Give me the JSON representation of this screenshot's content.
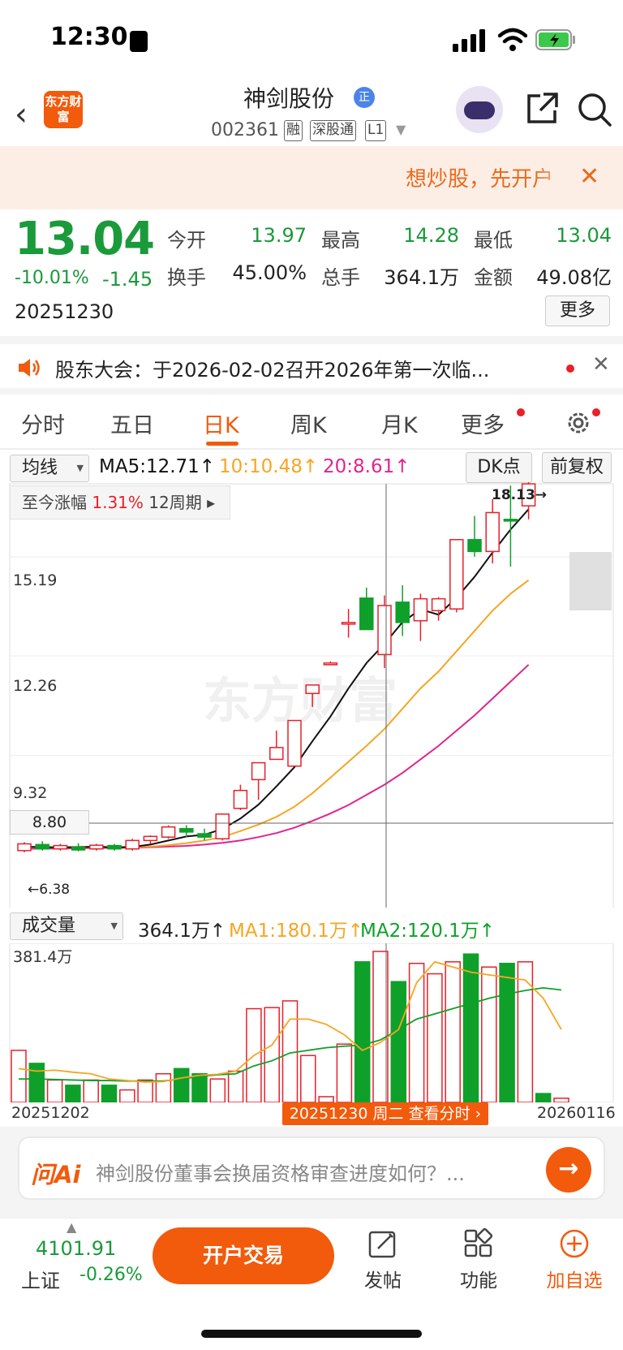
{
  "status": {
    "time": "12:30"
  },
  "header": {
    "logo": "东方财富",
    "title": "神剑股份",
    "title_badge": "正",
    "code": "002361",
    "tags": [
      "融",
      "深股通",
      "L1"
    ]
  },
  "banner": {
    "text": "想炒股，先开户"
  },
  "quote": {
    "price": "13.04",
    "change_pct": "-10.01%",
    "change": "-1.45",
    "date": "20251230",
    "fields": [
      {
        "label": "今开",
        "value": "13.97",
        "color": "#1a9a3a"
      },
      {
        "label": "最高",
        "value": "14.28",
        "color": "#1a9a3a"
      },
      {
        "label": "最低",
        "value": "13.04",
        "color": "#1a9a3a"
      },
      {
        "label": "换手",
        "value": "45.00%",
        "color": "#222222"
      },
      {
        "label": "总手",
        "value": "364.1万",
        "color": "#222222"
      },
      {
        "label": "金额",
        "value": "49.08亿",
        "color": "#222222"
      }
    ],
    "more": "更多"
  },
  "notice": {
    "text": "股东大会：于2026-02-02召开2026年第一次临..."
  },
  "tabs": [
    {
      "label": "分时"
    },
    {
      "label": "五日"
    },
    {
      "label": "日K",
      "active": true
    },
    {
      "label": "周K"
    },
    {
      "label": "月K"
    },
    {
      "label": "更多"
    }
  ],
  "chart": {
    "ma_select": "均线",
    "ma5": "MA5:12.71↑",
    "ma10": "10:10.48↑",
    "ma20": "20:8.61↑",
    "dk_button": "DK点",
    "adjust_button": "前复权",
    "period_label": "至今涨幅",
    "period_value": "1.31%",
    "period_span": "12周期",
    "y_labels": [
      "15.19",
      "12.26",
      "9.32"
    ],
    "crosshair_price": "8.80",
    "high_label": "18.13",
    "low_label": "6.38",
    "vol_select": "成交量",
    "vol_value": "364.1万↑",
    "vol_ma1": "MA1:180.1万↑",
    "vol_ma2": "MA2:120.1万↑",
    "vol_max": "381.4万",
    "x_start": "20251202",
    "x_end": "20260116",
    "crosshair_date": "20251230 周二 查看分时",
    "watermark": "东方财富",
    "colors": {
      "up": "#e8202a",
      "down": "#0fa02a",
      "ma5": "#111111",
      "ma10": "#f5a623",
      "ma20": "#e0258e"
    }
  },
  "chart_data": {
    "type": "candlestick",
    "x_range": [
      "20251202",
      "20260116"
    ],
    "y_ticks": [
      15.19,
      12.26,
      9.32
    ],
    "candles": [
      {
        "o": 6.5,
        "h": 6.75,
        "l": 6.45,
        "c": 6.7
      },
      {
        "o": 6.68,
        "h": 6.78,
        "l": 6.5,
        "c": 6.55
      },
      {
        "o": 6.55,
        "h": 6.7,
        "l": 6.5,
        "c": 6.65
      },
      {
        "o": 6.6,
        "h": 6.72,
        "l": 6.48,
        "c": 6.52
      },
      {
        "o": 6.55,
        "h": 6.7,
        "l": 6.5,
        "c": 6.66
      },
      {
        "o": 6.65,
        "h": 6.7,
        "l": 6.5,
        "c": 6.55
      },
      {
        "o": 6.55,
        "h": 6.85,
        "l": 6.5,
        "c": 6.8
      },
      {
        "o": 6.8,
        "h": 6.95,
        "l": 6.7,
        "c": 6.92
      },
      {
        "o": 6.9,
        "h": 7.25,
        "l": 6.85,
        "c": 7.2
      },
      {
        "o": 7.15,
        "h": 7.25,
        "l": 6.9,
        "c": 7.05
      },
      {
        "o": 7.0,
        "h": 7.15,
        "l": 6.8,
        "c": 6.9
      },
      {
        "o": 6.85,
        "h": 7.6,
        "l": 6.8,
        "c": 7.58
      },
      {
        "o": 7.75,
        "h": 8.45,
        "l": 7.7,
        "c": 8.28
      },
      {
        "o": 8.6,
        "h": 9.1,
        "l": 8.0,
        "c": 9.1
      },
      {
        "o": 9.2,
        "h": 10.05,
        "l": 9.2,
        "c": 9.55
      },
      {
        "o": 9.0,
        "h": 10.35,
        "l": 9.0,
        "c": 10.35
      },
      {
        "o": 11.15,
        "h": 11.4,
        "l": 10.75,
        "c": 11.4
      },
      {
        "o": 12.0,
        "h": 12.1,
        "l": 12.0,
        "c": 12.05
      },
      {
        "o": 13.25,
        "h": 13.65,
        "l": 12.8,
        "c": 13.25
      },
      {
        "o": 13.97,
        "h": 14.28,
        "l": 13.04,
        "c": 13.04
      },
      {
        "o": 12.3,
        "h": 14.05,
        "l": 11.9,
        "c": 13.75
      },
      {
        "o": 13.85,
        "h": 14.35,
        "l": 12.85,
        "c": 13.25
      },
      {
        "o": 13.3,
        "h": 14.1,
        "l": 12.7,
        "c": 13.95
      },
      {
        "o": 13.6,
        "h": 14.0,
        "l": 13.3,
        "c": 13.95
      },
      {
        "o": 13.65,
        "h": 15.7,
        "l": 13.55,
        "c": 15.7
      },
      {
        "o": 15.7,
        "h": 16.4,
        "l": 15.2,
        "c": 15.35
      },
      {
        "o": 15.35,
        "h": 16.9,
        "l": 15.0,
        "c": 16.5
      },
      {
        "o": 16.3,
        "h": 17.3,
        "l": 14.9,
        "c": 16.25
      },
      {
        "o": 16.7,
        "h": 18.13,
        "l": 16.3,
        "c": 17.35
      }
    ],
    "ma5": [
      6.62,
      6.6,
      6.6,
      6.6,
      6.62,
      6.59,
      6.61,
      6.68,
      6.8,
      6.92,
      6.97,
      7.14,
      7.45,
      7.86,
      8.4,
      8.97,
      9.74,
      10.47,
      11.3,
      12.05,
      12.62,
      13.26,
      13.64,
      13.48,
      13.98,
      14.6,
      15.32,
      16.0,
      16.6
    ],
    "ma10": [
      6.6,
      6.6,
      6.6,
      6.61,
      6.61,
      6.61,
      6.61,
      6.62,
      6.66,
      6.72,
      6.8,
      6.9,
      7.08,
      7.27,
      7.5,
      7.8,
      8.2,
      8.66,
      9.13,
      9.6,
      10.1,
      10.7,
      11.3,
      11.8,
      12.4,
      13.0,
      13.6,
      14.1,
      14.5
    ],
    "ma20": [
      6.55,
      6.56,
      6.56,
      6.57,
      6.58,
      6.58,
      6.59,
      6.6,
      6.62,
      6.64,
      6.68,
      6.73,
      6.8,
      6.9,
      7.02,
      7.18,
      7.38,
      7.6,
      7.85,
      8.15,
      8.45,
      8.8,
      9.2,
      9.6,
      10.05,
      10.5,
      11.0,
      11.5,
      12.0
    ],
    "volume": [
      100,
      75,
      43,
      33,
      43,
      33,
      24,
      43,
      55,
      65,
      55,
      45,
      60,
      180,
      182,
      195,
      90,
      11,
      112,
      270,
      290,
      232,
      267,
      247,
      270,
      285,
      260,
      267,
      270,
      17,
      8
    ],
    "vol_ma1": [
      65,
      60,
      62,
      58,
      55,
      45,
      42,
      39,
      40,
      47,
      52,
      54,
      60,
      90,
      110,
      160,
      160,
      150,
      130,
      100,
      115,
      140,
      230,
      270,
      260,
      250,
      245,
      240,
      235,
      200,
      140
    ],
    "vol_ma2": [
      45,
      45,
      44,
      43,
      42,
      42,
      41,
      41,
      41,
      45,
      50,
      53,
      55,
      70,
      80,
      95,
      100,
      105,
      108,
      110,
      120,
      140,
      160,
      170,
      180,
      190,
      200,
      208,
      215,
      220,
      216
    ]
  },
  "ai": {
    "logo": "问Ai",
    "prompt": "神剑股份董事会换届资格审查进度如何？..."
  },
  "bottom": {
    "index_value": "4101.91",
    "index_name": "上证",
    "index_pct": "-0.26%",
    "trade": "开户交易",
    "items": [
      {
        "label": "发帖",
        "icon": "edit-icon"
      },
      {
        "label": "功能",
        "icon": "grid-icon"
      },
      {
        "label": "加自选",
        "icon": "add-circle-icon"
      }
    ]
  }
}
